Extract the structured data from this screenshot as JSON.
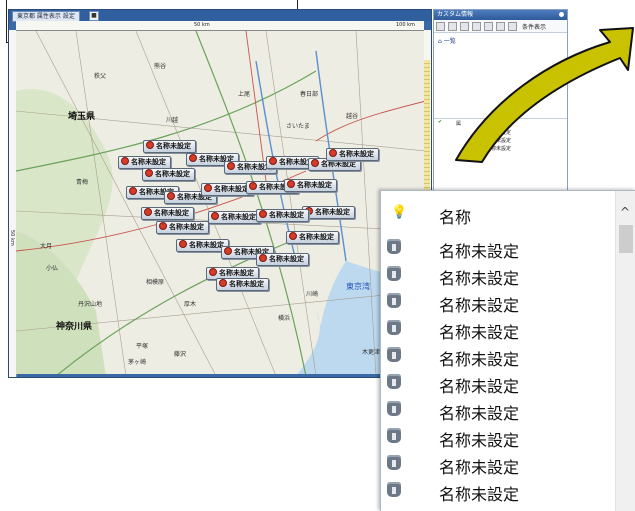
{
  "map_window": {
    "tab_label": "東京都 属性表示 設定",
    "ruler_top_ticks": [
      "50 km",
      "100 km"
    ],
    "ruler_left_label": "50 km",
    "places": [
      {
        "name": "埼玉県",
        "style": "big"
      },
      {
        "name": "神奈川県",
        "style": "big"
      },
      {
        "name": "東京湾",
        "style": "blue"
      },
      {
        "name": "さいたま",
        "style": "normal"
      },
      {
        "name": "川崎",
        "style": "normal"
      },
      {
        "name": "横浜",
        "style": "normal"
      },
      {
        "name": "相模原",
        "style": "normal"
      },
      {
        "name": "丹沢山地",
        "style": "normal"
      },
      {
        "name": "大月",
        "style": "normal"
      },
      {
        "name": "小仏",
        "style": "normal"
      },
      {
        "name": "青梅",
        "style": "normal"
      },
      {
        "name": "川越",
        "style": "normal"
      },
      {
        "name": "熊谷",
        "style": "normal"
      },
      {
        "name": "上尾",
        "style": "normal"
      },
      {
        "name": "春日部",
        "style": "normal"
      },
      {
        "name": "越谷",
        "style": "normal"
      },
      {
        "name": "秩父",
        "style": "normal"
      },
      {
        "name": "厚木",
        "style": "normal"
      },
      {
        "name": "藤沢",
        "style": "normal"
      },
      {
        "name": "茅ヶ崎",
        "style": "normal"
      },
      {
        "name": "平塚",
        "style": "normal"
      },
      {
        "name": "木更津",
        "style": "normal"
      }
    ],
    "marker_label": "名称未設定"
  },
  "panel": {
    "title": "カスタム情報",
    "toolbar_label": "条件表示",
    "tree_root": "一覧",
    "lower_header": "名称",
    "lower_root": "属",
    "lower_items": [
      "名称未設定",
      "名称未設定",
      "名称未設定"
    ]
  },
  "zoom_list": {
    "header_label": "名称",
    "header_icon": "bulb-icon",
    "row_icon": "pushpin-icon",
    "rows": [
      "名称未設定",
      "名称未設定",
      "名称未設定",
      "名称未設定",
      "名称未設定",
      "名称未設定",
      "名称未設定",
      "名称未設定",
      "名称未設定",
      "名称未設定"
    ]
  },
  "colors": {
    "arrow_fill": "#c8c200",
    "window_frame": "#3a6aa5",
    "marker_pin": "#d43c27"
  }
}
